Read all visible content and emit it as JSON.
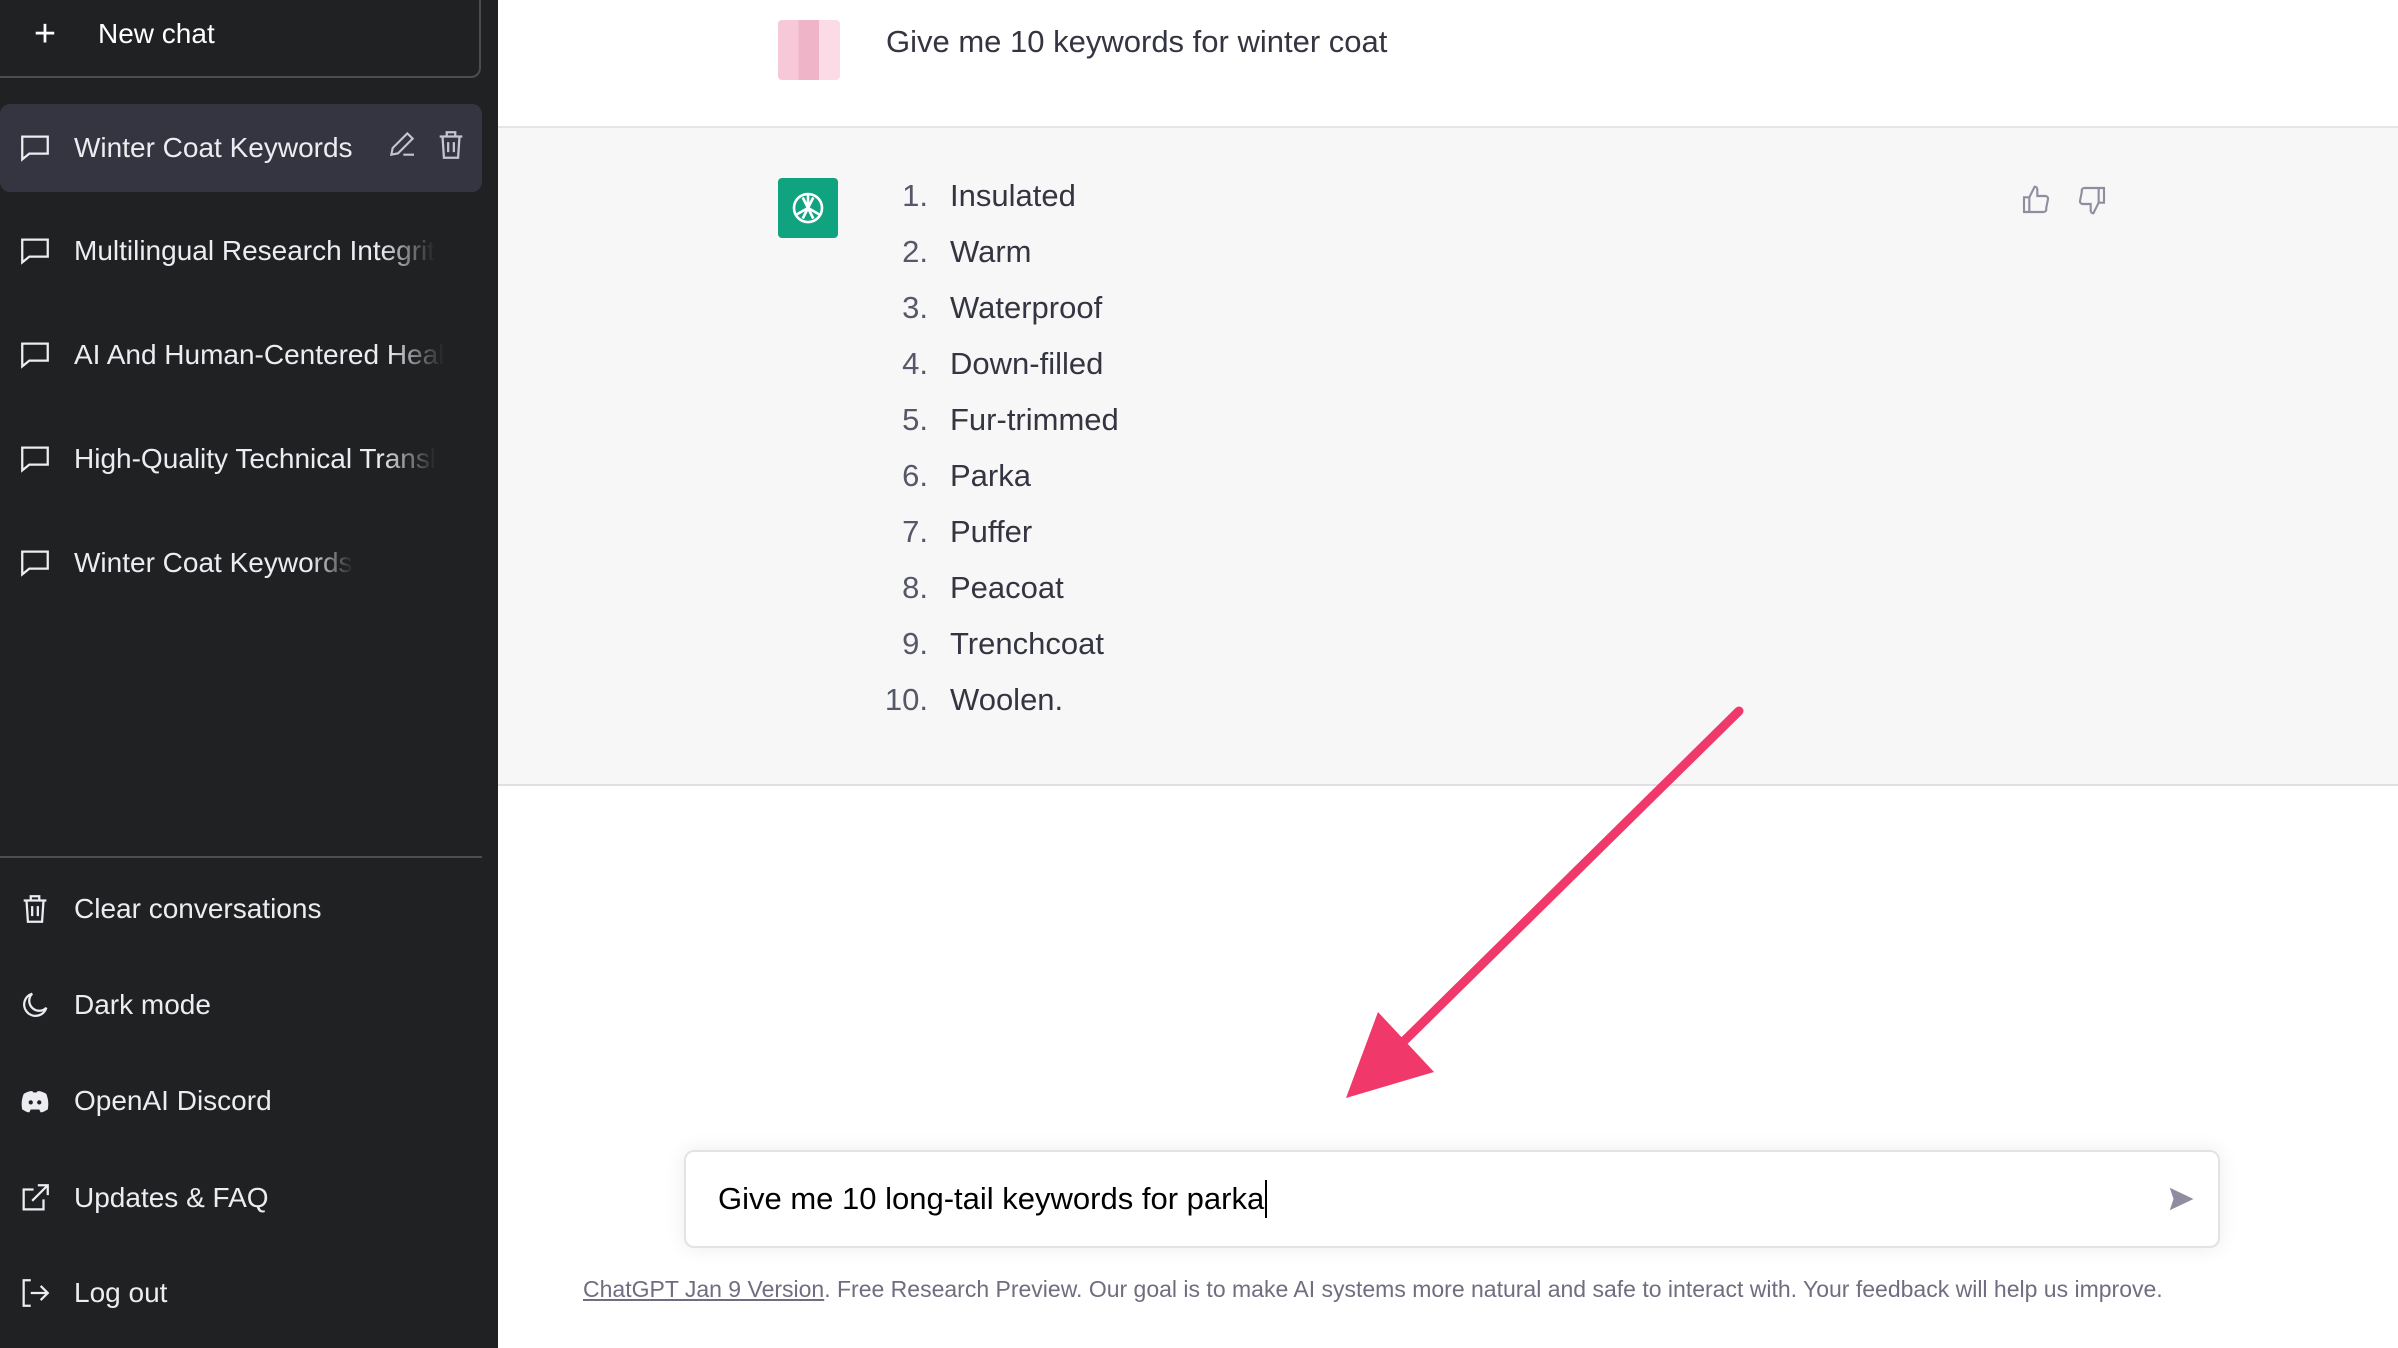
{
  "sidebar": {
    "new_chat": "New chat",
    "conversations": [
      {
        "title": "Winter Coat Keywords",
        "active": true
      },
      {
        "title": "Multilingual Research Integrit"
      },
      {
        "title": "AI And Human-Centered Heal"
      },
      {
        "title": "High-Quality Technical Transl"
      },
      {
        "title": "Winter Coat Keywords"
      }
    ],
    "bottom": [
      {
        "label": "Clear conversations",
        "icon": "trash-icon"
      },
      {
        "label": "Dark mode",
        "icon": "moon-icon"
      },
      {
        "label": "OpenAI Discord",
        "icon": "discord-icon"
      },
      {
        "label": "Updates & FAQ",
        "icon": "external-link-icon"
      },
      {
        "label": "Log out",
        "icon": "logout-icon"
      }
    ]
  },
  "chat": {
    "user_message": "Give me 10 keywords for winter coat",
    "assistant_list": [
      {
        "n": "1.",
        "text": "Insulated"
      },
      {
        "n": "2.",
        "text": "Warm"
      },
      {
        "n": "3.",
        "text": "Waterproof"
      },
      {
        "n": "4.",
        "text": "Down-filled"
      },
      {
        "n": "5.",
        "text": "Fur-trimmed"
      },
      {
        "n": "6.",
        "text": "Parka"
      },
      {
        "n": "7.",
        "text": "Puffer"
      },
      {
        "n": "8.",
        "text": "Peacoat"
      },
      {
        "n": "9.",
        "text": "Trenchcoat"
      },
      {
        "n": "10.",
        "text": "Woolen."
      }
    ]
  },
  "input": {
    "value": "Give me 10 long-tail keywords for parka"
  },
  "footer": {
    "link": "ChatGPT Jan 9 Version",
    "text": ". Free Research Preview. Our goal is to make AI systems more natural and safe to interact with. Your feedback will help us improve."
  },
  "colors": {
    "sidebar": "#202123",
    "brand": "#10a37f",
    "annotation_arrow": "#f0386b"
  }
}
